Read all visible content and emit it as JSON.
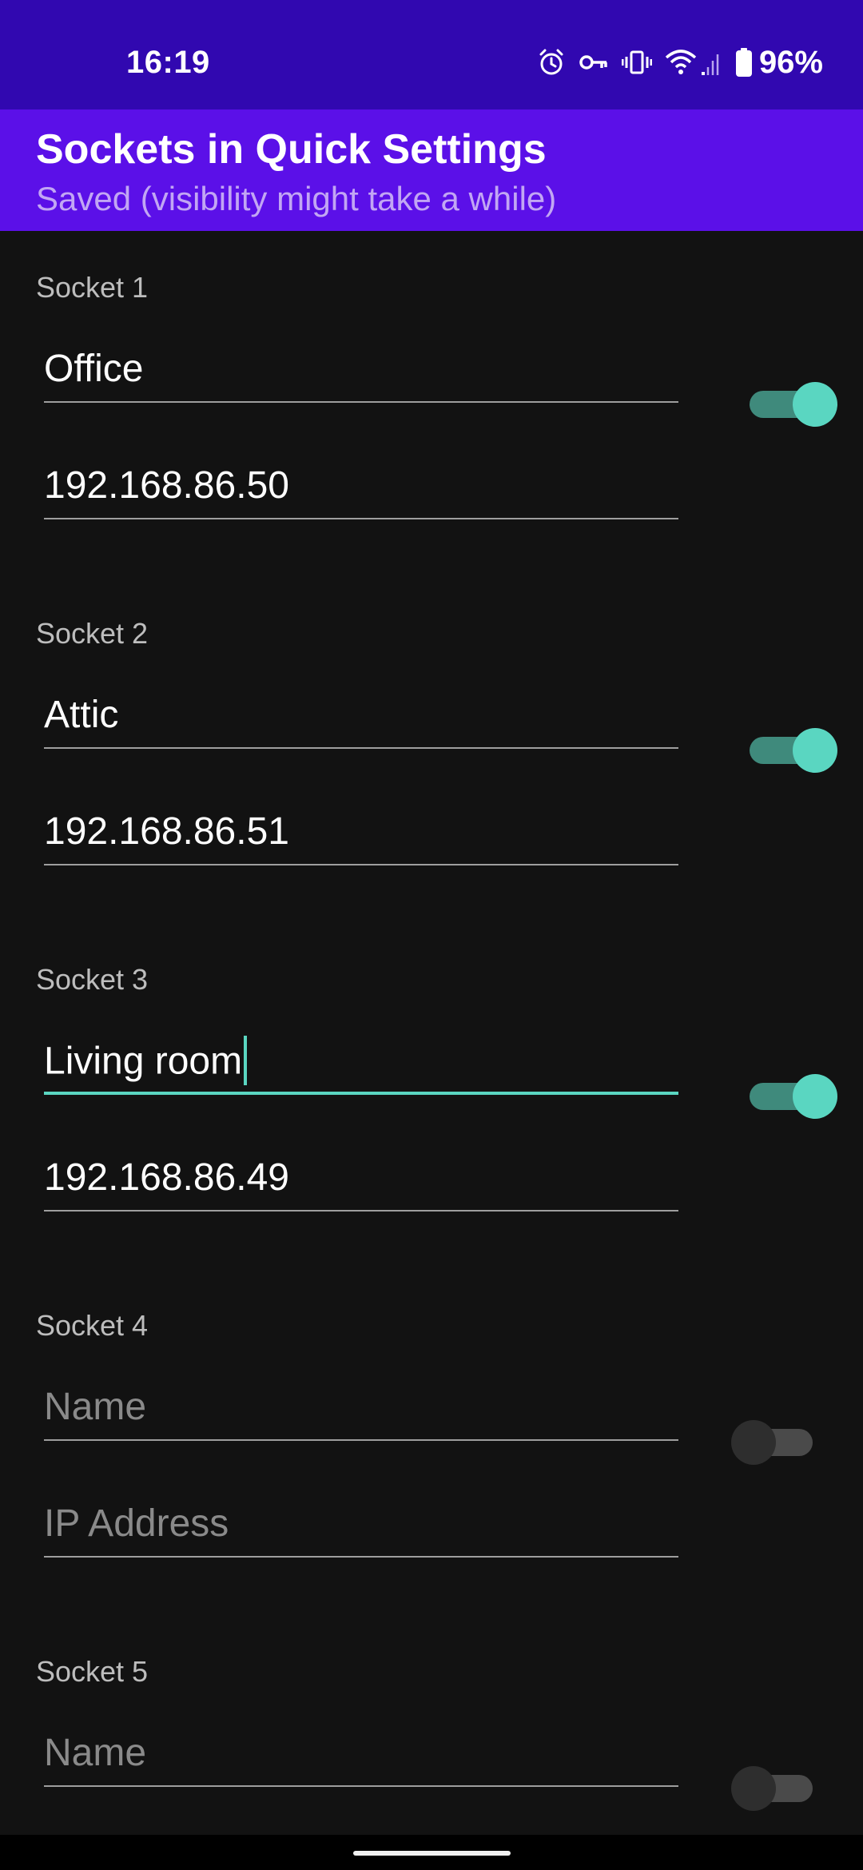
{
  "status_bar": {
    "time": "16:19",
    "battery_percent": "96%",
    "icons": [
      "alarm-icon",
      "vpn-key-icon",
      "vibrate-icon",
      "wifi-icon",
      "cell-signal-icon",
      "battery-icon"
    ]
  },
  "app_bar": {
    "title": "Sockets in Quick Settings",
    "subtitle": "Saved (visibility might take a while)"
  },
  "sockets": [
    {
      "label": "Socket 1",
      "name": "Office",
      "ip": "192.168.86.50",
      "enabled": true
    },
    {
      "label": "Socket 2",
      "name": "Attic",
      "ip": "192.168.86.51",
      "enabled": true
    },
    {
      "label": "Socket 3",
      "name": "Living room",
      "ip": "192.168.86.49",
      "enabled": true,
      "focused": true
    },
    {
      "label": "Socket 4",
      "name": "",
      "ip": "",
      "enabled": false
    },
    {
      "label": "Socket 5",
      "name": "",
      "ip": "",
      "enabled": false
    }
  ],
  "placeholders": {
    "name": "Name",
    "ip": "IP Address"
  },
  "colors": {
    "status_bar": "#3108b0",
    "app_bar": "#5b10e8",
    "accent": "#5ad6c1",
    "background": "#121212"
  }
}
